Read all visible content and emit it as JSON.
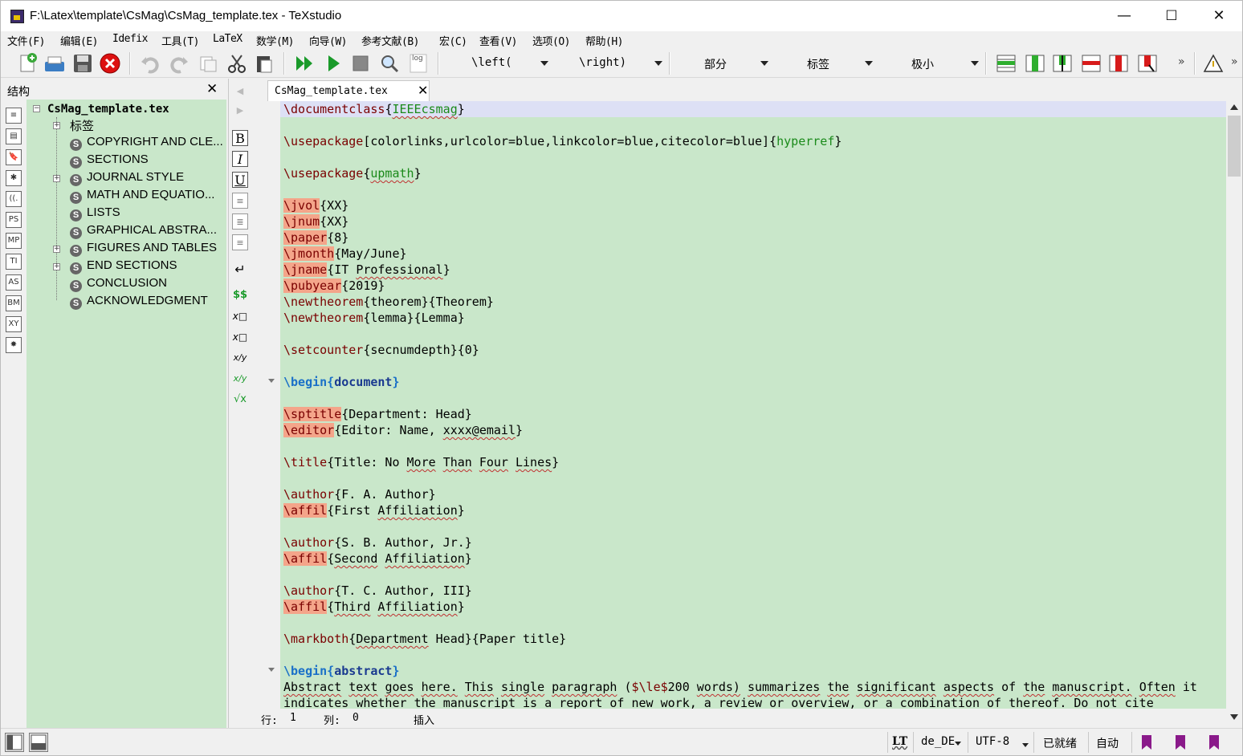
{
  "window": {
    "title": "F:\\Latex\\template\\CsMag\\CsMag_template.tex - TeXstudio",
    "minimize": "—",
    "maximize": "☐",
    "close": "✕"
  },
  "menu": [
    "文件(F)",
    "编辑(E)",
    "Idefix",
    "工具(T)",
    "LaTeX",
    "数学(M)",
    "向导(W)",
    "参考文献(B)",
    "宏(C)",
    "查看(V)",
    "选项(O)",
    "帮助(H)"
  ],
  "toolbar": {
    "combos": [
      "\\left(",
      "\\right)",
      "部分",
      "标签",
      "极小"
    ],
    "log_label": "log",
    "more": "»",
    "icons": [
      "new-file-icon",
      "print-icon",
      "save-icon",
      "close-doc-icon",
      "undo-icon",
      "redo-icon",
      "copy-icon",
      "cut-icon",
      "paste-icon",
      "build-view-icon",
      "compile-icon",
      "stop-icon",
      "view-icon",
      "log-icon",
      "table-row-add-icon",
      "table-col-add-icon",
      "table-cell-icon",
      "table-row-del-icon",
      "table-col-del-icon",
      "table-cell-del-icon",
      "warning-icon"
    ]
  },
  "structure": {
    "title": "结构",
    "close": "✕",
    "root": "CsMag_template.tex",
    "items": [
      {
        "label": "标签",
        "expandable": true,
        "icon": false
      },
      {
        "label": "COPYRIGHT AND CLE...",
        "expandable": false,
        "icon": true
      },
      {
        "label": "SECTIONS",
        "expandable": false,
        "icon": true
      },
      {
        "label": "JOURNAL STYLE",
        "expandable": true,
        "icon": true
      },
      {
        "label": "MATH AND EQUATIO...",
        "expandable": false,
        "icon": true
      },
      {
        "label": "LISTS",
        "expandable": false,
        "icon": true
      },
      {
        "label": "GRAPHICAL ABSTRA...",
        "expandable": false,
        "icon": true
      },
      {
        "label": "FIGURES AND TABLES",
        "expandable": true,
        "icon": true
      },
      {
        "label": "END SECTIONS",
        "expandable": true,
        "icon": true
      },
      {
        "label": "CONCLUSION",
        "expandable": false,
        "icon": true
      },
      {
        "label": "ACKNOWLEDGMENT",
        "expandable": false,
        "icon": true
      }
    ],
    "side_icons": [
      "structure-icon",
      "toc-icon",
      "bookmark-icon",
      "symbols-icon",
      "brackets-icon",
      "pstricks-icon",
      "metapost-icon",
      "tikz-icon",
      "asymptote-icon",
      "beamer-icon",
      "xy-icon",
      "macros-icon"
    ],
    "side_labels": [
      "≡",
      "▤",
      "🔖",
      "✱",
      "((.",
      "PS",
      "MP",
      "TI",
      "AS",
      "BM",
      "XY",
      "✸"
    ]
  },
  "vbar": {
    "labels": [
      "◀",
      "▶",
      "B",
      "I",
      "U",
      "≡",
      "≣",
      "≡",
      "↵",
      "$$",
      "x□",
      "x□",
      "x/y",
      "x/y",
      "√x"
    ]
  },
  "editor": {
    "tab_label": "CsMag_template.tex",
    "tab_close": "✕",
    "lines": [
      "\\documentclass{IEEEcsmag}",
      "",
      "\\usepackage[colorlinks,urlcolor=blue,linkcolor=blue,citecolor=blue]{hyperref}",
      "",
      "\\usepackage{upmath}",
      "",
      "\\jvol{XX}",
      "\\jnum{XX}",
      "\\paper{8}",
      "\\jmonth{May/June}",
      "\\jname{IT Professional}",
      "\\pubyear{2019}",
      "\\newtheorem{theorem}{Theorem}",
      "\\newtheorem{lemma}{Lemma}",
      "",
      "\\setcounter{secnumdepth}{0}",
      "",
      "\\begin{document}",
      "",
      "\\sptitle{Department: Head}",
      "\\editor{Editor: Name, xxxx@email}",
      "",
      "\\title{Title: No More Than Four Lines}",
      "",
      "\\author{F. A. Author}",
      "\\affil{First Affiliation}",
      "",
      "\\author{S. B. Author, Jr.}",
      "\\affil{Second Affiliation}",
      "",
      "\\author{T. C. Author, III}",
      "\\affil{Third Affiliation}",
      "",
      "\\markboth{Department Head}{Paper title}",
      "",
      "\\begin{abstract}",
      "Abstract text goes here. This single paragraph ($\\le$200 words) summarizes the significant aspects of the manuscript. Often it",
      "indicates whether the manuscript is a report of new work, a review or overview, or a combination of thereof. Do not cite"
    ]
  },
  "position": {
    "line_label": "行:",
    "line": "1",
    "col_label": "列:",
    "col": "0",
    "mode": "插入"
  },
  "status": {
    "spell_label": "LT",
    "language": "de_DE",
    "encoding": "UTF-8",
    "ready": "已就绪",
    "auto": "自动"
  }
}
